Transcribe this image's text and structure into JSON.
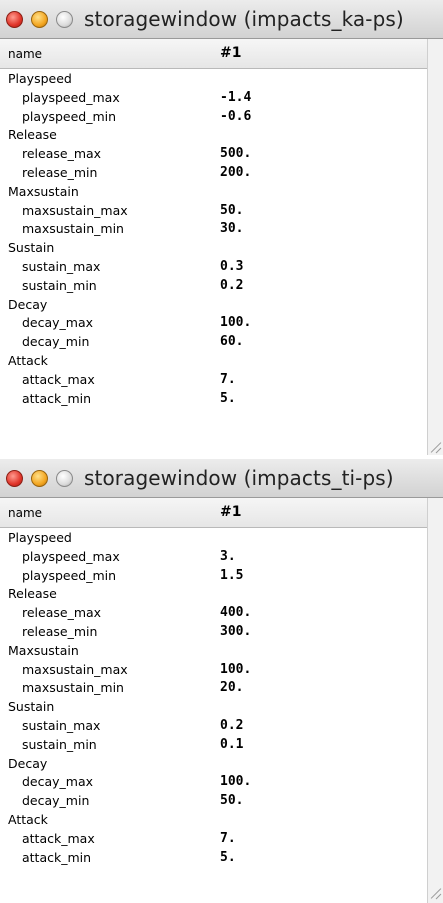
{
  "windows": [
    {
      "title": "storagewindow (impacts_ka-ps)",
      "header": {
        "name": "name",
        "col": "#1"
      },
      "rows": [
        {
          "label": "Playspeed",
          "value": "",
          "child": false
        },
        {
          "label": "playspeed_max",
          "value": "-1.4",
          "child": true
        },
        {
          "label": "playspeed_min",
          "value": "-0.6",
          "child": true
        },
        {
          "label": "Release",
          "value": "",
          "child": false
        },
        {
          "label": "release_max",
          "value": "500.",
          "child": true
        },
        {
          "label": "release_min",
          "value": "200.",
          "child": true
        },
        {
          "label": "Maxsustain",
          "value": "",
          "child": false
        },
        {
          "label": "maxsustain_max",
          "value": "50.",
          "child": true
        },
        {
          "label": "maxsustain_min",
          "value": "30.",
          "child": true
        },
        {
          "label": "Sustain",
          "value": "",
          "child": false
        },
        {
          "label": "sustain_max",
          "value": "0.3",
          "child": true
        },
        {
          "label": "sustain_min",
          "value": "0.2",
          "child": true
        },
        {
          "label": "Decay",
          "value": "",
          "child": false
        },
        {
          "label": "decay_max",
          "value": "100.",
          "child": true
        },
        {
          "label": "decay_min",
          "value": "60.",
          "child": true
        },
        {
          "label": "Attack",
          "value": "",
          "child": false
        },
        {
          "label": "attack_max",
          "value": "7.",
          "child": true
        },
        {
          "label": "attack_min",
          "value": "5.",
          "child": true
        }
      ]
    },
    {
      "title": "storagewindow (impacts_ti-ps)",
      "header": {
        "name": "name",
        "col": "#1"
      },
      "rows": [
        {
          "label": "Playspeed",
          "value": "",
          "child": false
        },
        {
          "label": "playspeed_max",
          "value": "3.",
          "child": true
        },
        {
          "label": "playspeed_min",
          "value": "1.5",
          "child": true
        },
        {
          "label": "Release",
          "value": "",
          "child": false
        },
        {
          "label": "release_max",
          "value": "400.",
          "child": true
        },
        {
          "label": "release_min",
          "value": "300.",
          "child": true
        },
        {
          "label": "Maxsustain",
          "value": "",
          "child": false
        },
        {
          "label": "maxsustain_max",
          "value": "100.",
          "child": true
        },
        {
          "label": "maxsustain_min",
          "value": "20.",
          "child": true
        },
        {
          "label": "Sustain",
          "value": "",
          "child": false
        },
        {
          "label": "sustain_max",
          "value": "0.2",
          "child": true
        },
        {
          "label": "sustain_min",
          "value": "0.1",
          "child": true
        },
        {
          "label": "Decay",
          "value": "",
          "child": false
        },
        {
          "label": "decay_max",
          "value": "100.",
          "child": true
        },
        {
          "label": "decay_min",
          "value": "50.",
          "child": true
        },
        {
          "label": "Attack",
          "value": "",
          "child": false
        },
        {
          "label": "attack_max",
          "value": "7.",
          "child": true
        },
        {
          "label": "attack_min",
          "value": "5.",
          "child": true
        }
      ]
    }
  ]
}
